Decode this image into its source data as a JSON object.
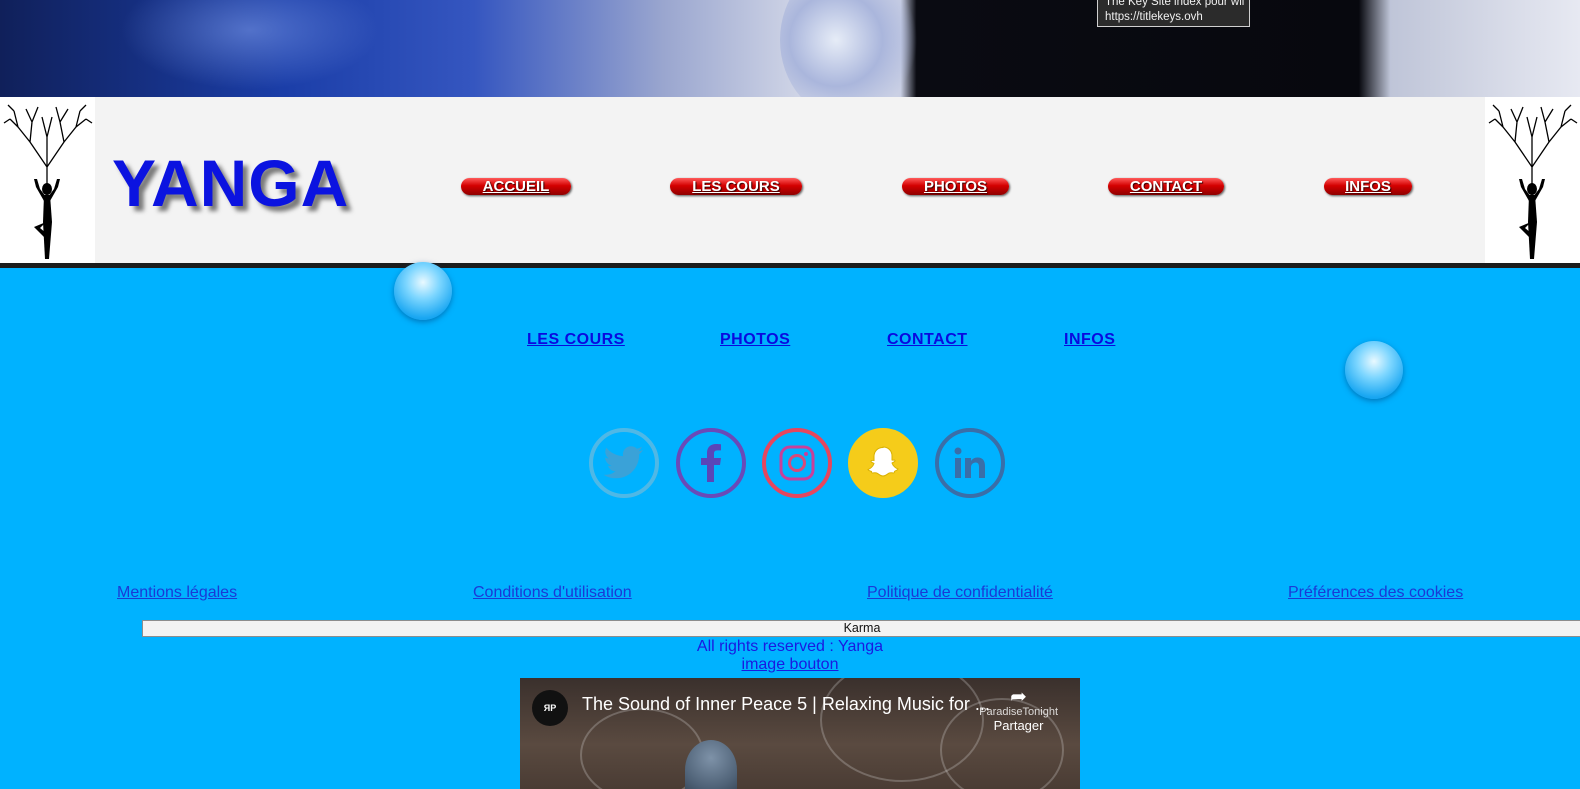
{
  "tooltip": {
    "line1": "The Key Site index pour wii",
    "line2": "https://titlekeys.ovh"
  },
  "header": {
    "logo": "YANGA",
    "nav": [
      "ACCUEIL",
      "LES COURS",
      "PHOTOS",
      "CONTACT",
      "INFOS"
    ]
  },
  "subnav": [
    "LES COURS",
    "PHOTOS",
    "CONTACT",
    "INFOS"
  ],
  "social": [
    "twitter-icon",
    "facebook-icon",
    "instagram-icon",
    "snapchat-icon",
    "linkedin-icon"
  ],
  "footer": {
    "links": [
      "Mentions légales",
      "Conditions d'utilisation",
      "Politique de confidentialité",
      "Préférences des cookies"
    ],
    "karma": "Karma",
    "rights": "All rights reserved : Yanga",
    "image_button_alt": "image bouton"
  },
  "video": {
    "channel": "ParadiseTonight",
    "title": "The Sound of Inner Peace 5 | Relaxing Music for ...",
    "share": "Partager"
  },
  "colors": {
    "page_bg": "#00b2ff",
    "logo": "#0b13e0",
    "nav_button": "#d40000"
  }
}
